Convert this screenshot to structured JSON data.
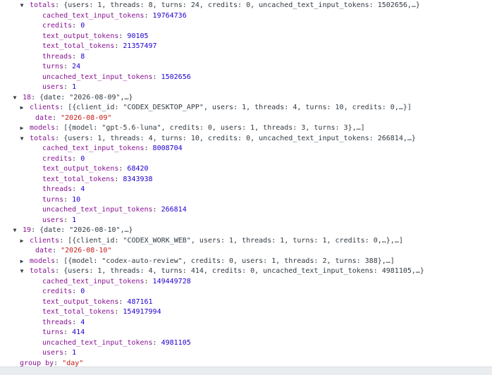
{
  "lines": [
    {
      "arrow": "▼",
      "key": "totals",
      "preview": "{users: 1, threads: 8, turns: 24, credits: 0, uncached_text_input_tokens: 1502656,…}"
    },
    {
      "key": "cached_text_input_tokens",
      "value": "19764736",
      "vtype": "num"
    },
    {
      "key": "credits",
      "value": "0",
      "vtype": "num"
    },
    {
      "key": "text_output_tokens",
      "value": "90105",
      "vtype": "num"
    },
    {
      "key": "text_total_tokens",
      "value": "21357497",
      "vtype": "num"
    },
    {
      "key": "threads",
      "value": "8",
      "vtype": "num"
    },
    {
      "key": "turns",
      "value": "24",
      "vtype": "num"
    },
    {
      "key": "uncached_text_input_tokens",
      "value": "1502656",
      "vtype": "num"
    },
    {
      "key": "users",
      "value": "1",
      "vtype": "num"
    },
    {
      "arrow": "▼",
      "key": "18",
      "preview": "{date: \"2026-08-09\",…}"
    },
    {
      "arrow": "▶",
      "key": "clients",
      "preview": "[{client_id: \"CODEX_DESKTOP_APP\", users: 1, threads: 4, turns: 10, credits: 0,…}]"
    },
    {
      "key": "date",
      "value": "\"2026-08-09\"",
      "vtype": "str"
    },
    {
      "arrow": "▶",
      "key": "models",
      "preview": "[{model: \"gpt-5.6-luna\", credits: 0, users: 1, threads: 3, turns: 3},…]"
    },
    {
      "arrow": "▼",
      "key": "totals",
      "preview": "{users: 1, threads: 4, turns: 10, credits: 0, uncached_text_input_tokens: 266814,…}"
    },
    {
      "key": "cached_text_input_tokens",
      "value": "8008704",
      "vtype": "num"
    },
    {
      "key": "credits",
      "value": "0",
      "vtype": "num"
    },
    {
      "key": "text_output_tokens",
      "value": "68420",
      "vtype": "num"
    },
    {
      "key": "text_total_tokens",
      "value": "8343938",
      "vtype": "num"
    },
    {
      "key": "threads",
      "value": "4",
      "vtype": "num"
    },
    {
      "key": "turns",
      "value": "10",
      "vtype": "num"
    },
    {
      "key": "uncached_text_input_tokens",
      "value": "266814",
      "vtype": "num"
    },
    {
      "key": "users",
      "value": "1",
      "vtype": "num"
    },
    {
      "arrow": "▼",
      "key": "19",
      "preview": "{date: \"2026-08-10\",…}"
    },
    {
      "arrow": "▶",
      "key": "clients",
      "preview": "[{client_id: \"CODEX_WORK_WEB\", users: 1, threads: 1, turns: 1, credits: 0,…},…]"
    },
    {
      "key": "date",
      "value": "\"2026-08-10\"",
      "vtype": "str"
    },
    {
      "arrow": "▶",
      "key": "models",
      "preview": "[{model: \"codex-auto-review\", credits: 0, users: 1, threads: 2, turns: 388},…]"
    },
    {
      "arrow": "▼",
      "key": "totals",
      "preview": "{users: 1, threads: 4, turns: 414, credits: 0, uncached_text_input_tokens: 4981105,…}"
    },
    {
      "key": "cached_text_input_tokens",
      "value": "149449728",
      "vtype": "num"
    },
    {
      "key": "credits",
      "value": "0",
      "vtype": "num"
    },
    {
      "key": "text_output_tokens",
      "value": "487161",
      "vtype": "num"
    },
    {
      "key": "text_total_tokens",
      "value": "154917994",
      "vtype": "num"
    },
    {
      "key": "threads",
      "value": "4",
      "vtype": "num"
    },
    {
      "key": "turns",
      "value": "414",
      "vtype": "num"
    },
    {
      "key": "uncached_text_input_tokens",
      "value": "4981105",
      "vtype": "num"
    },
    {
      "key": "users",
      "value": "1",
      "vtype": "num"
    },
    {
      "key": "group_by",
      "value": "\"day\"",
      "vtype": "str"
    }
  ]
}
